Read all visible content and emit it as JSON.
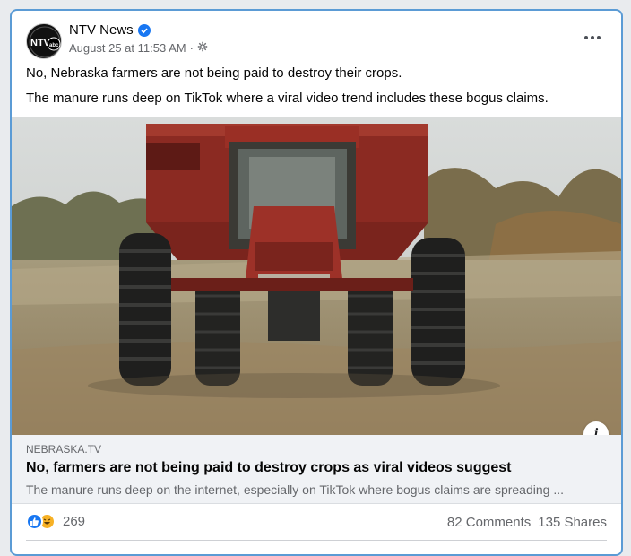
{
  "post": {
    "page_name": "NTV News",
    "avatar_text": "NTV",
    "avatar_sub": "abc",
    "timestamp": "August 25 at 11:53 AM",
    "separator": "·",
    "text_line_1": "No, Nebraska farmers are not being paid to destroy their crops.",
    "text_line_2": "The manure runs deep on TikTok where a viral video trend includes these bogus claims."
  },
  "link": {
    "domain": "NEBRASKA.TV",
    "headline": "No, farmers are not being paid to destroy crops as viral videos suggest",
    "description": "The manure runs deep on the internet, especially on TikTok where bogus claims are spreading ...",
    "info_label": "i"
  },
  "stats": {
    "reaction_count": "269",
    "comments": "82 Comments",
    "shares": "135 Shares"
  },
  "icons": {
    "verified": "verified-badge-icon",
    "audience": "globe-icon",
    "more": "more-options-icon",
    "like": "like-reaction-icon",
    "haha": "haha-reaction-icon"
  },
  "colors": {
    "accent": "#1877f2",
    "card_border": "#5b9bd5",
    "tractor_red": "#8b2a22"
  }
}
